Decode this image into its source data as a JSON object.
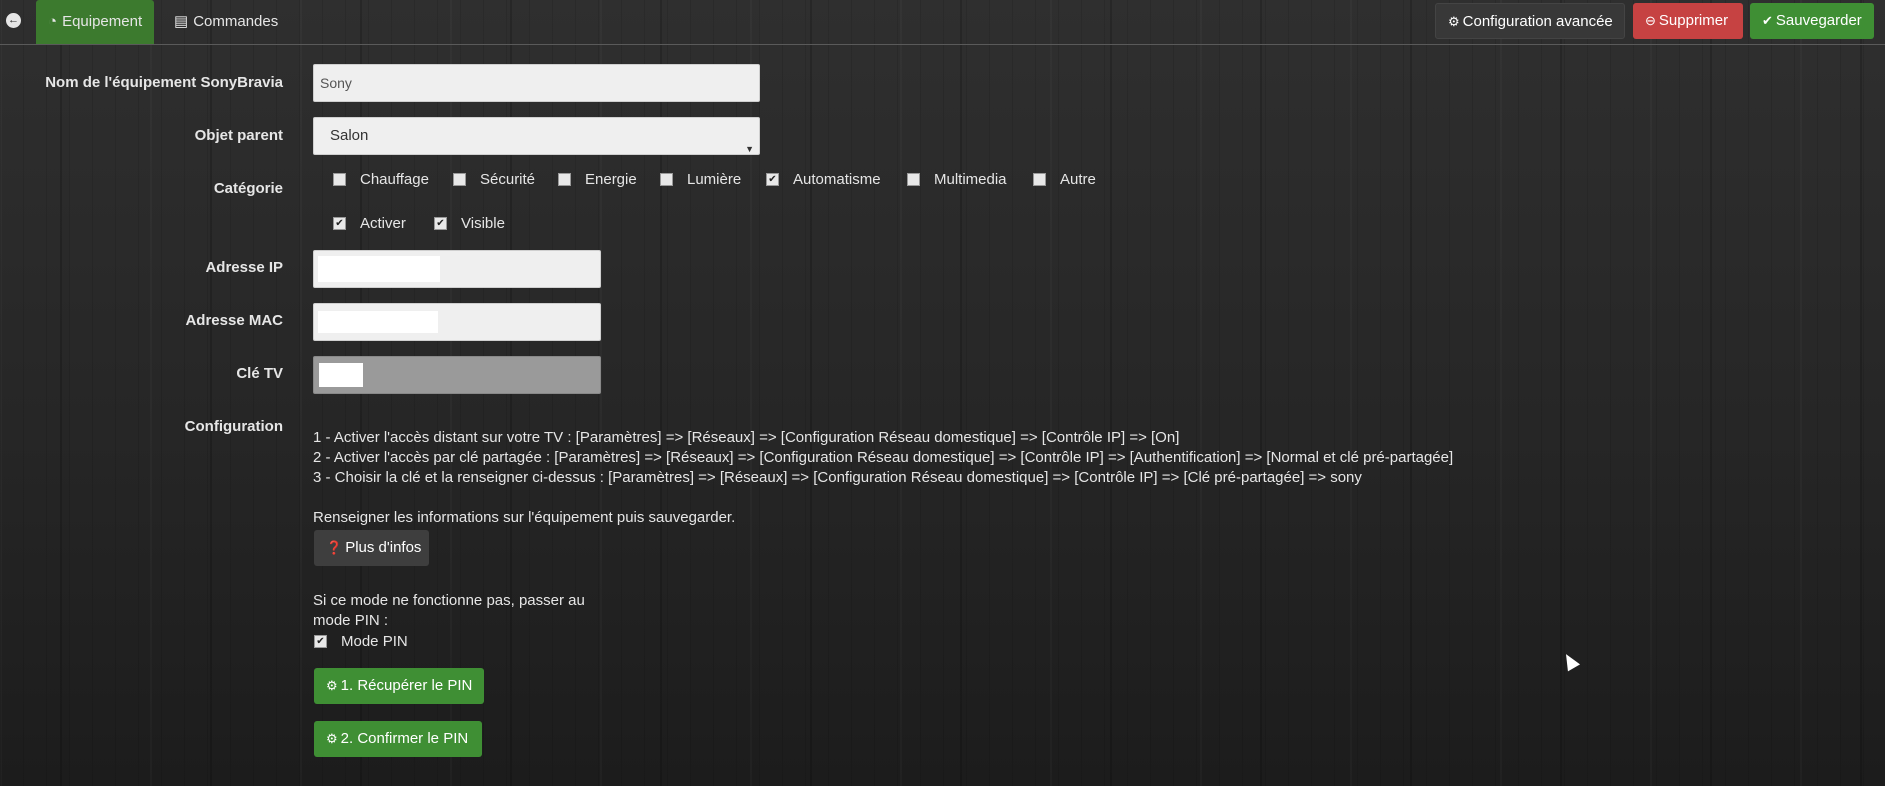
{
  "tabs": {
    "equipement": "Equipement",
    "commandes": "Commandes"
  },
  "header_buttons": {
    "config_avancee": "Configuration avancée",
    "supprimer": "Supprimer",
    "sauvegarder": "Sauvegarder"
  },
  "form": {
    "nom_label": "Nom de l'équipement SonyBravia",
    "nom_value": "Sony",
    "parent_label": "Objet parent",
    "parent_value": "Salon",
    "categorie_label": "Catégorie",
    "categories": [
      {
        "label": "Chauffage",
        "checked": false
      },
      {
        "label": "Sécurité",
        "checked": false
      },
      {
        "label": "Energie",
        "checked": false
      },
      {
        "label": "Lumière",
        "checked": false
      },
      {
        "label": "Automatisme",
        "checked": true
      },
      {
        "label": "Multimedia",
        "checked": false
      },
      {
        "label": "Autre",
        "checked": false
      }
    ],
    "activer": {
      "label": "Activer",
      "checked": true
    },
    "visible": {
      "label": "Visible",
      "checked": true
    },
    "ip_label": "Adresse IP",
    "mac_label": "Adresse MAC",
    "cle_label": "Clé TV",
    "config_label": "Configuration"
  },
  "instructions": {
    "line1": "1 - Activer l'accès distant sur votre TV : [Paramètres] => [Réseaux] => [Configuration Réseau domestique] => [Contrôle IP] => [On]",
    "line2": "2 - Activer l'accès par clé partagée : [Paramètres] => [Réseaux] => [Configuration Réseau domestique] => [Contrôle IP] => [Authentification] => [Normal et clé pré-partagée]",
    "line3": "3 - Choisir la clé et la renseigner ci-dessus : [Paramètres] => [Réseaux] => [Configuration Réseau domestique] => [Contrôle IP] => [Clé pré-partagée] => sony",
    "renseigner": "Renseigner les informations sur l'équipement puis sauvegarder.",
    "plus_infos": "Plus d'infos",
    "pin_hint_line1": "Si ce mode ne fonctionne pas, passer au",
    "pin_hint_line2": "mode PIN :",
    "mode_pin": {
      "label": "Mode PIN",
      "checked": true
    },
    "recuperer_pin": "1. Récupérer le PIN",
    "confirmer_pin": "2. Confirmer le PIN"
  },
  "colors": {
    "accent_green": "#3c7a2e",
    "danger_red": "#c64242"
  }
}
